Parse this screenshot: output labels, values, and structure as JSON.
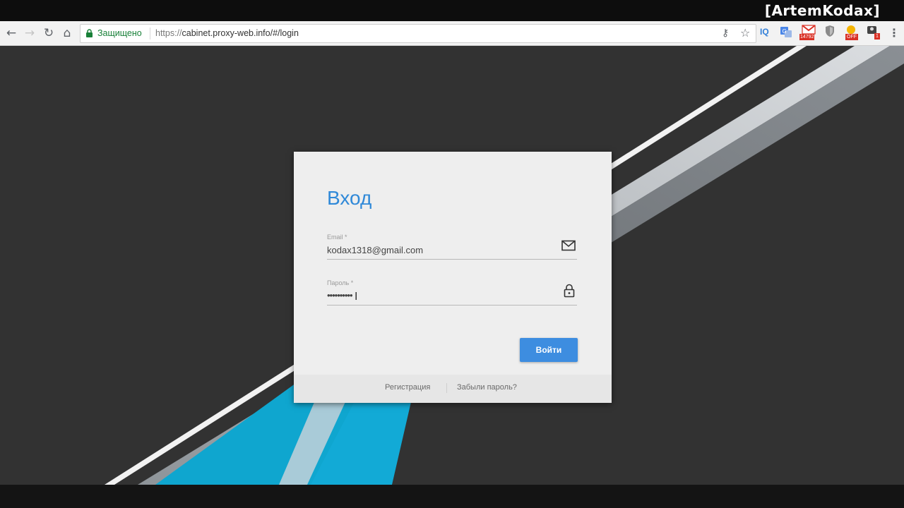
{
  "watermark": "[ArtemKodax]",
  "browser": {
    "secure_label": "Защищено",
    "url_scheme": "https://",
    "url_rest": "cabinet.proxy-web.info/#/login",
    "extensions": [
      {
        "name": "iq-extension-icon",
        "label": "IQ"
      },
      {
        "name": "translate-extension-icon"
      },
      {
        "name": "gmail-extension-icon",
        "badge": "14792"
      },
      {
        "name": "shield-extension-icon"
      },
      {
        "name": "lock-extension-icon",
        "badge": "OFF"
      },
      {
        "name": "user-extension-icon",
        "badge": "1"
      }
    ]
  },
  "login": {
    "title": "Вход",
    "email_label": "Email *",
    "email_value": "kodax1318@gmail.com",
    "password_label": "Пароль *",
    "password_value": "••••••••••",
    "submit_label": "Войти",
    "register_link": "Регистрация",
    "forgot_link": "Забыли пароль?"
  },
  "colors": {
    "accent": "#3d8de0",
    "title_blue": "#3089d8",
    "background": "#323232",
    "stripe_cyan": "#0fa6cf"
  }
}
